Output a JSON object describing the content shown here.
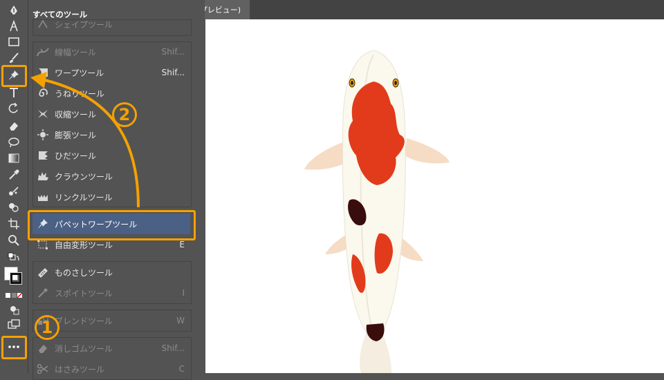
{
  "panel": {
    "title": "すべてのツール",
    "items": [
      {
        "label": "シェイプツール",
        "shortcut": "",
        "icon": "shape-icon"
      },
      {
        "label": "線幅ツール",
        "shortcut": "Shif...",
        "icon": "width-icon"
      },
      {
        "label": "ワープツール",
        "shortcut": "Shif...",
        "icon": "warp-icon"
      },
      {
        "label": "うねりツール",
        "shortcut": "",
        "icon": "twirl-icon"
      },
      {
        "label": "収縮ツール",
        "shortcut": "",
        "icon": "pucker-icon"
      },
      {
        "label": "膨張ツール",
        "shortcut": "",
        "icon": "bloat-icon"
      },
      {
        "label": "ひだツール",
        "shortcut": "",
        "icon": "scallop-icon"
      },
      {
        "label": "クラウンツール",
        "shortcut": "",
        "icon": "crystallize-icon"
      },
      {
        "label": "リンクルツール",
        "shortcut": "",
        "icon": "wrinkle-icon"
      },
      {
        "label": "パペットワープツール",
        "shortcut": "",
        "icon": "pin-icon"
      },
      {
        "label": "自由変形ツール",
        "shortcut": "E",
        "icon": "free-transform-icon"
      },
      {
        "label": "ものさしツール",
        "shortcut": "",
        "icon": "ruler-icon"
      },
      {
        "label": "スポイトツール",
        "shortcut": "I",
        "icon": "eyedropper-icon"
      },
      {
        "label": "ブレンドツール",
        "shortcut": "W",
        "icon": "blend-icon"
      },
      {
        "label": "消しゴムツール",
        "shortcut": "Shif...",
        "icon": "eraser-icon"
      },
      {
        "label": "はさみツール",
        "shortcut": "C",
        "icon": "scissors-icon"
      }
    ]
  },
  "document": {
    "tab_label": "/プレビュー)"
  },
  "annotations": {
    "badge1": "1",
    "badge2": "2"
  },
  "colors": {
    "accent": "#f4a100",
    "selected_row": "#4b6085",
    "koi_red": "#e23b1c",
    "koi_body": "#fbf8ee"
  }
}
